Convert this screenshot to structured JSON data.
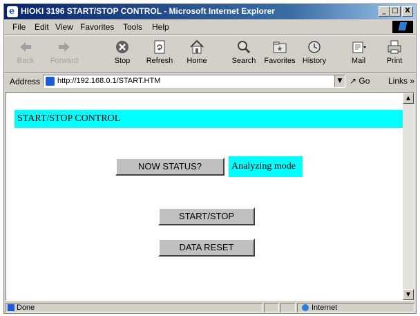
{
  "window": {
    "title": "HIOKI 3196 START/STOP CONTROL - Microsoft Internet Explorer",
    "controls": {
      "minimize": "_",
      "maximize": "□",
      "close": "X"
    }
  },
  "menu": [
    "File",
    "Edit",
    "View",
    "Favorites",
    "Tools",
    "Help"
  ],
  "toolbar": {
    "back": "Back",
    "forward": "Forward",
    "stop": "Stop",
    "refresh": "Refresh",
    "home": "Home",
    "search": "Search",
    "favorites": "Favorites",
    "history": "History",
    "mail": "Mail",
    "print": "Print"
  },
  "address": {
    "label": "Address",
    "url": "http://192.168.0.1/START.HTM",
    "go": "Go",
    "links": "Links",
    "links_chevron": "»"
  },
  "page": {
    "header": "START/STOP CONTROL",
    "status_button": "NOW STATUS?",
    "status_value": "Analyzing mode",
    "start_stop_button": "START/STOP",
    "data_reset_button": "DATA RESET"
  },
  "statusbar": {
    "left": "Done",
    "zone": "Internet"
  },
  "colors": {
    "highlight": "#00ffff",
    "titlebar_start": "#0a246a",
    "titlebar_end": "#a6caf0"
  }
}
